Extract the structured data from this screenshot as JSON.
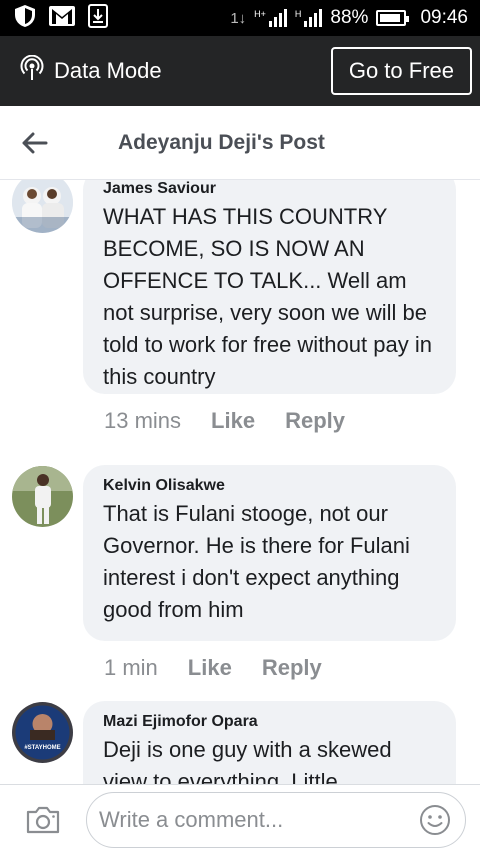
{
  "status_bar": {
    "data_speed": "1↓",
    "sim1_label": "H+",
    "sim2_label": "H",
    "battery_percent": "88%",
    "time": "09:46"
  },
  "data_mode_bar": {
    "label": "Data Mode",
    "go_free_label": "Go to Free"
  },
  "header": {
    "title": "Adeyanju Deji's Post"
  },
  "comments": [
    {
      "author": "James Saviour",
      "text": "WHAT HAS THIS COUNTRY BECOME, SO IS NOW AN OFFENCE TO TALK... Well am not surprise, very soon we will be told to work for free without pay in this country",
      "time": "13 mins",
      "like_label": "Like",
      "reply_label": "Reply"
    },
    {
      "author": "Kelvin Olisakwe",
      "text": "That is Fulani stooge, not our Governor. He is there for Fulani interest i don't expect anything good from him",
      "time": "1 min",
      "like_label": "Like",
      "reply_label": "Reply"
    },
    {
      "author": "Mazi Ejimofor Opara",
      "text": "Deji is one guy with a skewed view to everything. Little",
      "avatar_text": "#STAYHOME"
    }
  ],
  "composer": {
    "placeholder": "Write a comment..."
  },
  "colors": {
    "status_bar_bg": "#000000",
    "data_bar_bg": "#242526",
    "bubble_bg": "#f0f2f5",
    "meta_text": "#8a8d91",
    "title_text": "#4b4f56"
  }
}
